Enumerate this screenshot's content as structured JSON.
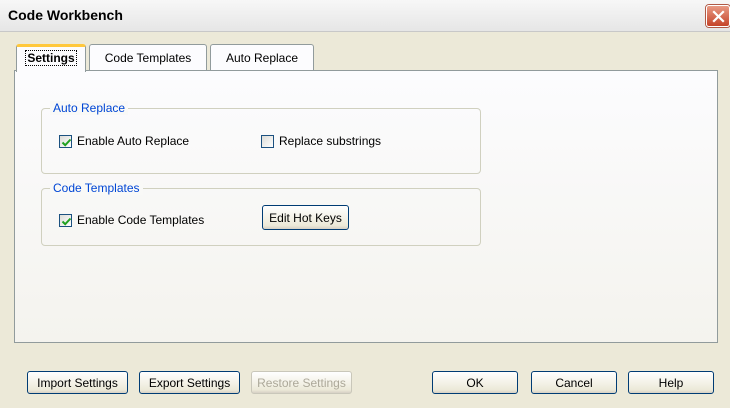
{
  "window": {
    "title": "Code Workbench"
  },
  "tabs": [
    {
      "label": "Settings",
      "active": true
    },
    {
      "label": "Code Templates",
      "active": false
    },
    {
      "label": "Auto Replace",
      "active": false
    }
  ],
  "auto_replace_group": {
    "title": "Auto Replace",
    "enable_label": "Enable Auto Replace",
    "enable_checked": true,
    "substrings_label": "Replace substrings",
    "substrings_checked": false
  },
  "code_templates_group": {
    "title": "Code Templates",
    "enable_label": "Enable Code Templates",
    "enable_checked": true,
    "hotkeys_label": "Edit Hot Keys"
  },
  "footer": {
    "import_label": "Import Settings",
    "export_label": "Export Settings",
    "restore_label": "Restore Settings",
    "ok_label": "OK",
    "cancel_label": "Cancel",
    "help_label": "Help"
  },
  "colors": {
    "group_title": "#0046d5",
    "tab_active_accent": "#ffc83c",
    "close_button": "#c5442a",
    "checkmark": "#21a121"
  },
  "icons": {
    "close": "close-icon",
    "check": "checkmark-icon"
  }
}
